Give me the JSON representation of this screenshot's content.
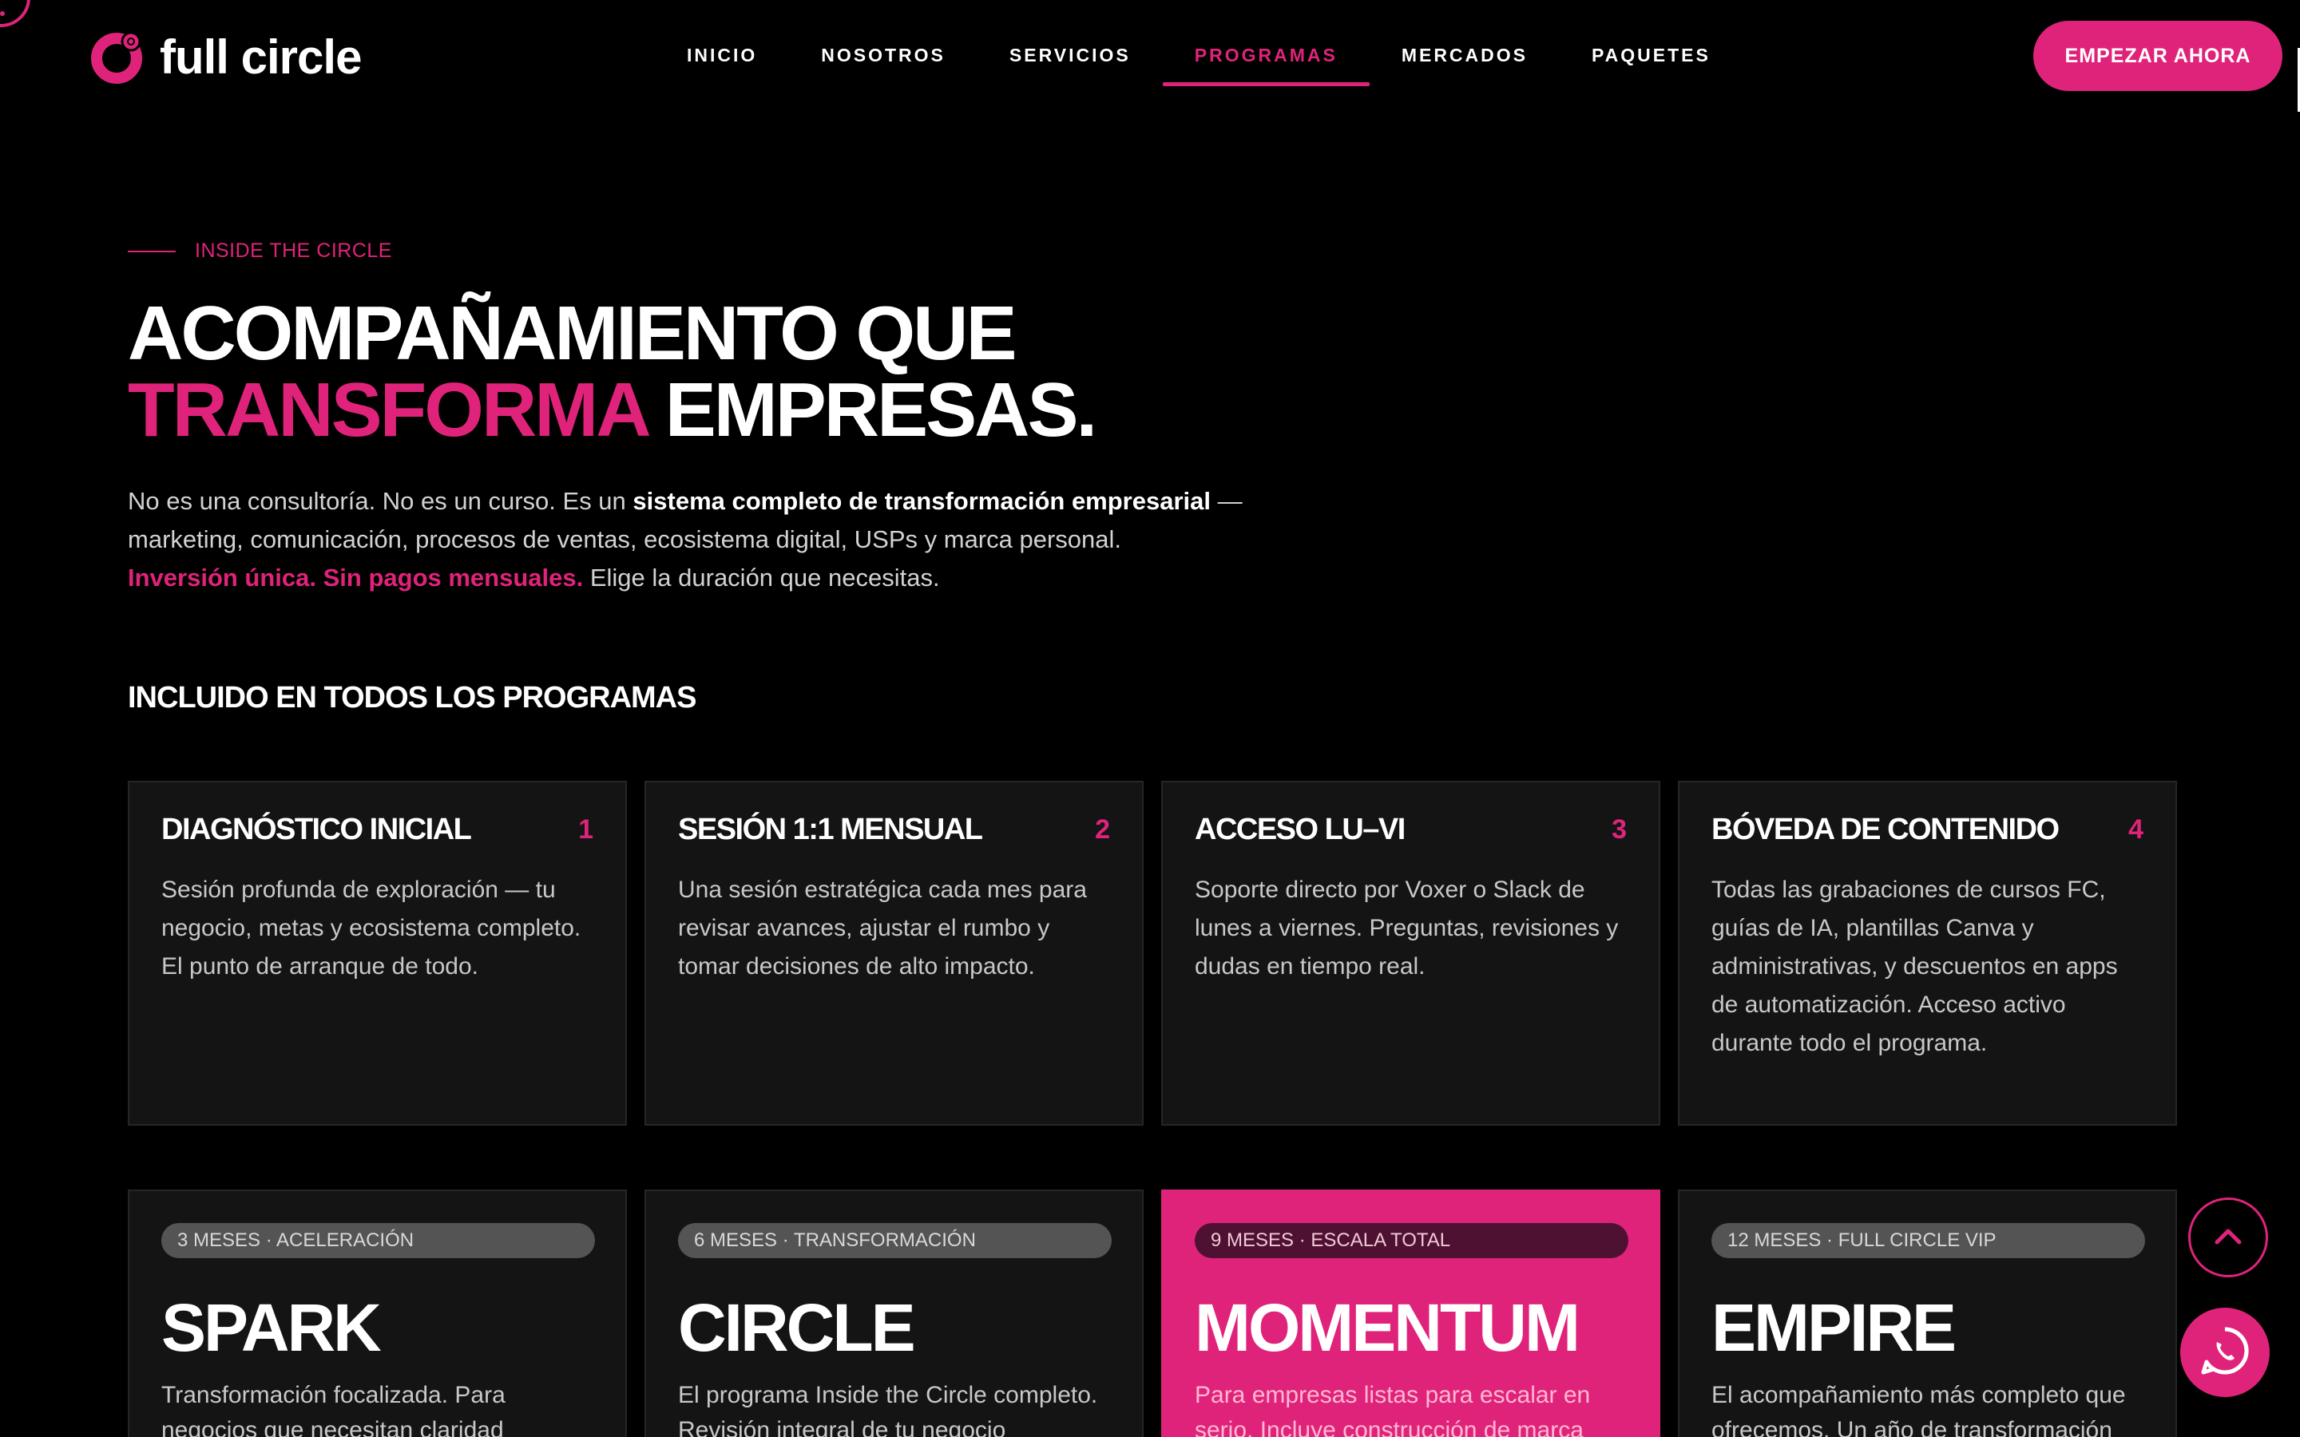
{
  "brand": {
    "name": "full circle",
    "accent": "#e0237a"
  },
  "nav": {
    "items": [
      "INICIO",
      "NOSOTROS",
      "SERVICIOS",
      "PROGRAMAS",
      "MERCADOS",
      "PAQUETES"
    ],
    "active": "PROGRAMAS",
    "cta": "EMPEZAR AHORA"
  },
  "hero": {
    "eyebrow": "INSIDE THE CIRCLE",
    "headline_line1": "ACOMPAÑAMIENTO QUE",
    "headline_highlight": "TRANSFORMA",
    "headline_rest": " EMPRESAS.",
    "intro_part1": "No es una consultoría. No es un curso. Es un ",
    "intro_bold": "sistema completo de transformación empresarial",
    "intro_part2": " — marketing, comunicación, procesos de ventas, ecosistema digital, USPs y marca personal.",
    "intro_highlight": "Inversión única. Sin pagos mensuales.",
    "intro_part3": " Elige la duración que necesitas."
  },
  "included": {
    "title": "INCLUIDO EN TODOS LOS PROGRAMAS",
    "cards": [
      {
        "num": "1",
        "title": "DIAGNÓSTICO INICIAL",
        "desc": "Sesión profunda de exploración — tu negocio, metas y ecosistema completo. El punto de arranque de todo."
      },
      {
        "num": "2",
        "title": "SESIÓN 1:1 MENSUAL",
        "desc": "Una sesión estratégica cada mes para revisar avances, ajustar el rumbo y tomar decisiones de alto impacto."
      },
      {
        "num": "3",
        "title": "ACCESO LU–VI",
        "desc": "Soporte directo por Voxer o Slack de lunes a viernes. Preguntas, revisiones y dudas en tiempo real."
      },
      {
        "num": "4",
        "title": "BÓVEDA DE CONTENIDO",
        "desc": "Todas las grabaciones de cursos FC, guías de IA, plantillas Canva y administrativas, y descuentos en apps de automatización. Acceso activo durante todo el programa."
      }
    ]
  },
  "programs": [
    {
      "tag": "3 MESES · ACELERACIÓN",
      "name": "SPARK",
      "desc": "Transformación focalizada. Para negocios que necesitan claridad"
    },
    {
      "tag": "6 MESES · TRANSFORMACIÓN",
      "name": "CIRCLE",
      "desc": "El programa Inside the Circle completo. Revisión integral de tu negocio"
    },
    {
      "tag": "9 MESES · ESCALA TOTAL",
      "name": "MOMENTUM",
      "desc": "Para empresas listas para escalar en serio. Incluye construcción de marca"
    },
    {
      "tag": "12 MESES · FULL CIRCLE VIP",
      "name": "EMPIRE",
      "desc": "El acompañamiento más completo que ofrecemos. Un año de transformación"
    }
  ],
  "icons": {
    "scroll_top": "chevron-up-icon",
    "whatsapp": "whatsapp-icon"
  }
}
